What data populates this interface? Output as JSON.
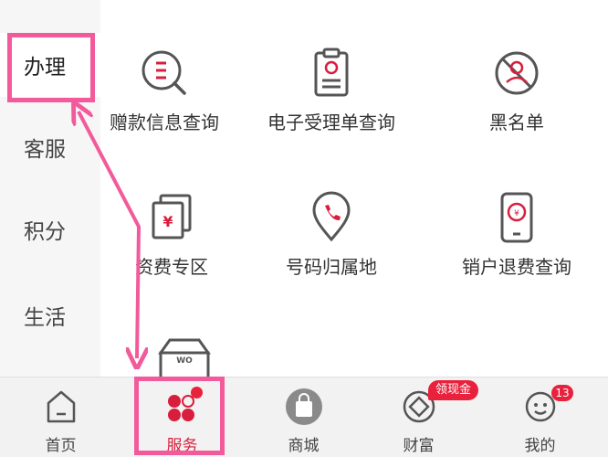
{
  "sidebar": {
    "items": [
      {
        "label": "办理",
        "active": true
      },
      {
        "label": "客服"
      },
      {
        "label": "积分"
      },
      {
        "label": "生活"
      }
    ]
  },
  "services": [
    {
      "label": "赠款信息查询",
      "icon": "search-list-icon"
    },
    {
      "label": "电子受理单查询",
      "icon": "clipboard-icon"
    },
    {
      "label": "黑名单",
      "icon": "blocked-user-icon"
    },
    {
      "label": "资费专区",
      "icon": "yuan-cards-icon"
    },
    {
      "label": "号码归属地",
      "icon": "location-phone-icon"
    },
    {
      "label": "销户退费查询",
      "icon": "refund-phone-icon"
    }
  ],
  "partial_service": {
    "icon_text": "WO"
  },
  "tabbar": {
    "tabs": [
      {
        "label": "首页",
        "icon": "home-icon"
      },
      {
        "label": "服务",
        "icon": "service-icon",
        "active": true
      },
      {
        "label": "商城",
        "icon": "shopping-bag-icon"
      },
      {
        "label": "财富",
        "icon": "wealth-icon",
        "badge": "领现金"
      },
      {
        "label": "我的",
        "icon": "profile-icon",
        "badge": "13"
      }
    ]
  },
  "colors": {
    "accent": "#d81e3c",
    "highlight": "#f25a9b",
    "icon_red": "#d81e3c"
  }
}
